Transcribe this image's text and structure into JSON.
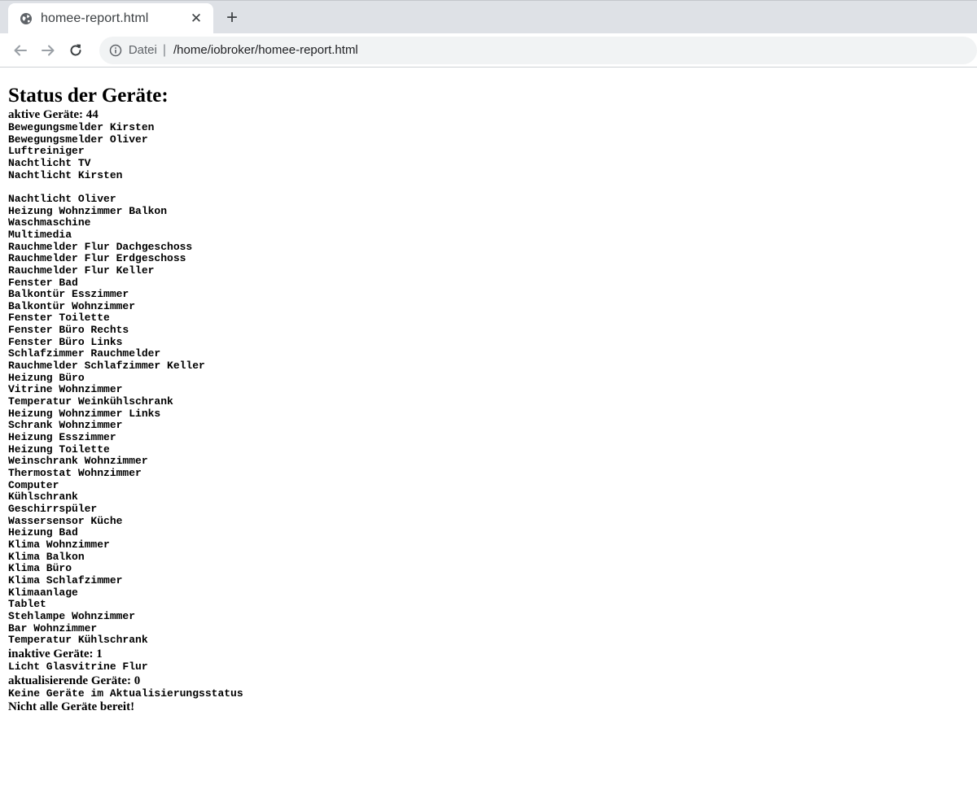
{
  "browser": {
    "tab_title": "homee-report.html",
    "new_tab_label": "+",
    "address_scheme": "Datei",
    "address_separator": "|",
    "address_url": "/home/iobroker/homee-report.html"
  },
  "report": {
    "title": "Status der Geräte:",
    "active_header": "aktive Geräte: 44",
    "active_devices_group1": [
      "Bewegungsmelder Kirsten",
      "Bewegungsmelder Oliver",
      "Luftreiniger",
      "Nachtlicht TV",
      "Nachtlicht Kirsten"
    ],
    "active_devices_group2": [
      "Nachtlicht Oliver",
      "Heizung Wohnzimmer Balkon",
      "Waschmaschine",
      "Multimedia",
      "Rauchmelder Flur Dachgeschoss",
      "Rauchmelder Flur Erdgeschoss",
      "Rauchmelder Flur Keller",
      "Fenster Bad",
      "Balkontür Esszimmer",
      "Balkontür Wohnzimmer",
      "Fenster Toilette",
      "Fenster Büro Rechts",
      "Fenster Büro Links",
      "Schlafzimmer Rauchmelder",
      "Rauchmelder Schlafzimmer Keller",
      "Heizung Büro",
      "Vitrine Wohnzimmer",
      "Temperatur Weinkühlschrank",
      "Heizung Wohnzimmer Links",
      "Schrank Wohnzimmer",
      "Heizung Esszimmer",
      "Heizung Toilette",
      "Weinschrank Wohnzimmer",
      "Thermostat Wohnzimmer",
      "Computer",
      "Kühlschrank",
      "Geschirrspüler",
      "Wassersensor Küche",
      "Heizung Bad",
      "Klima Wohnzimmer",
      "Klima Balkon",
      "Klima Büro",
      "Klima Schlafzimmer",
      "Klimaanlage",
      "Tablet",
      "Stehlampe Wohnzimmer",
      "Bar Wohnzimmer",
      "Temperatur Kühlschrank"
    ],
    "inactive_header": "inaktive Geräte: 1",
    "inactive_devices": [
      "Licht Glasvitrine Flur"
    ],
    "updating_header": "aktualisierende Geräte: 0",
    "updating_text": "Keine Geräte im Aktualisierungsstatus",
    "final_status": "Nicht alle Geräte bereit!"
  }
}
